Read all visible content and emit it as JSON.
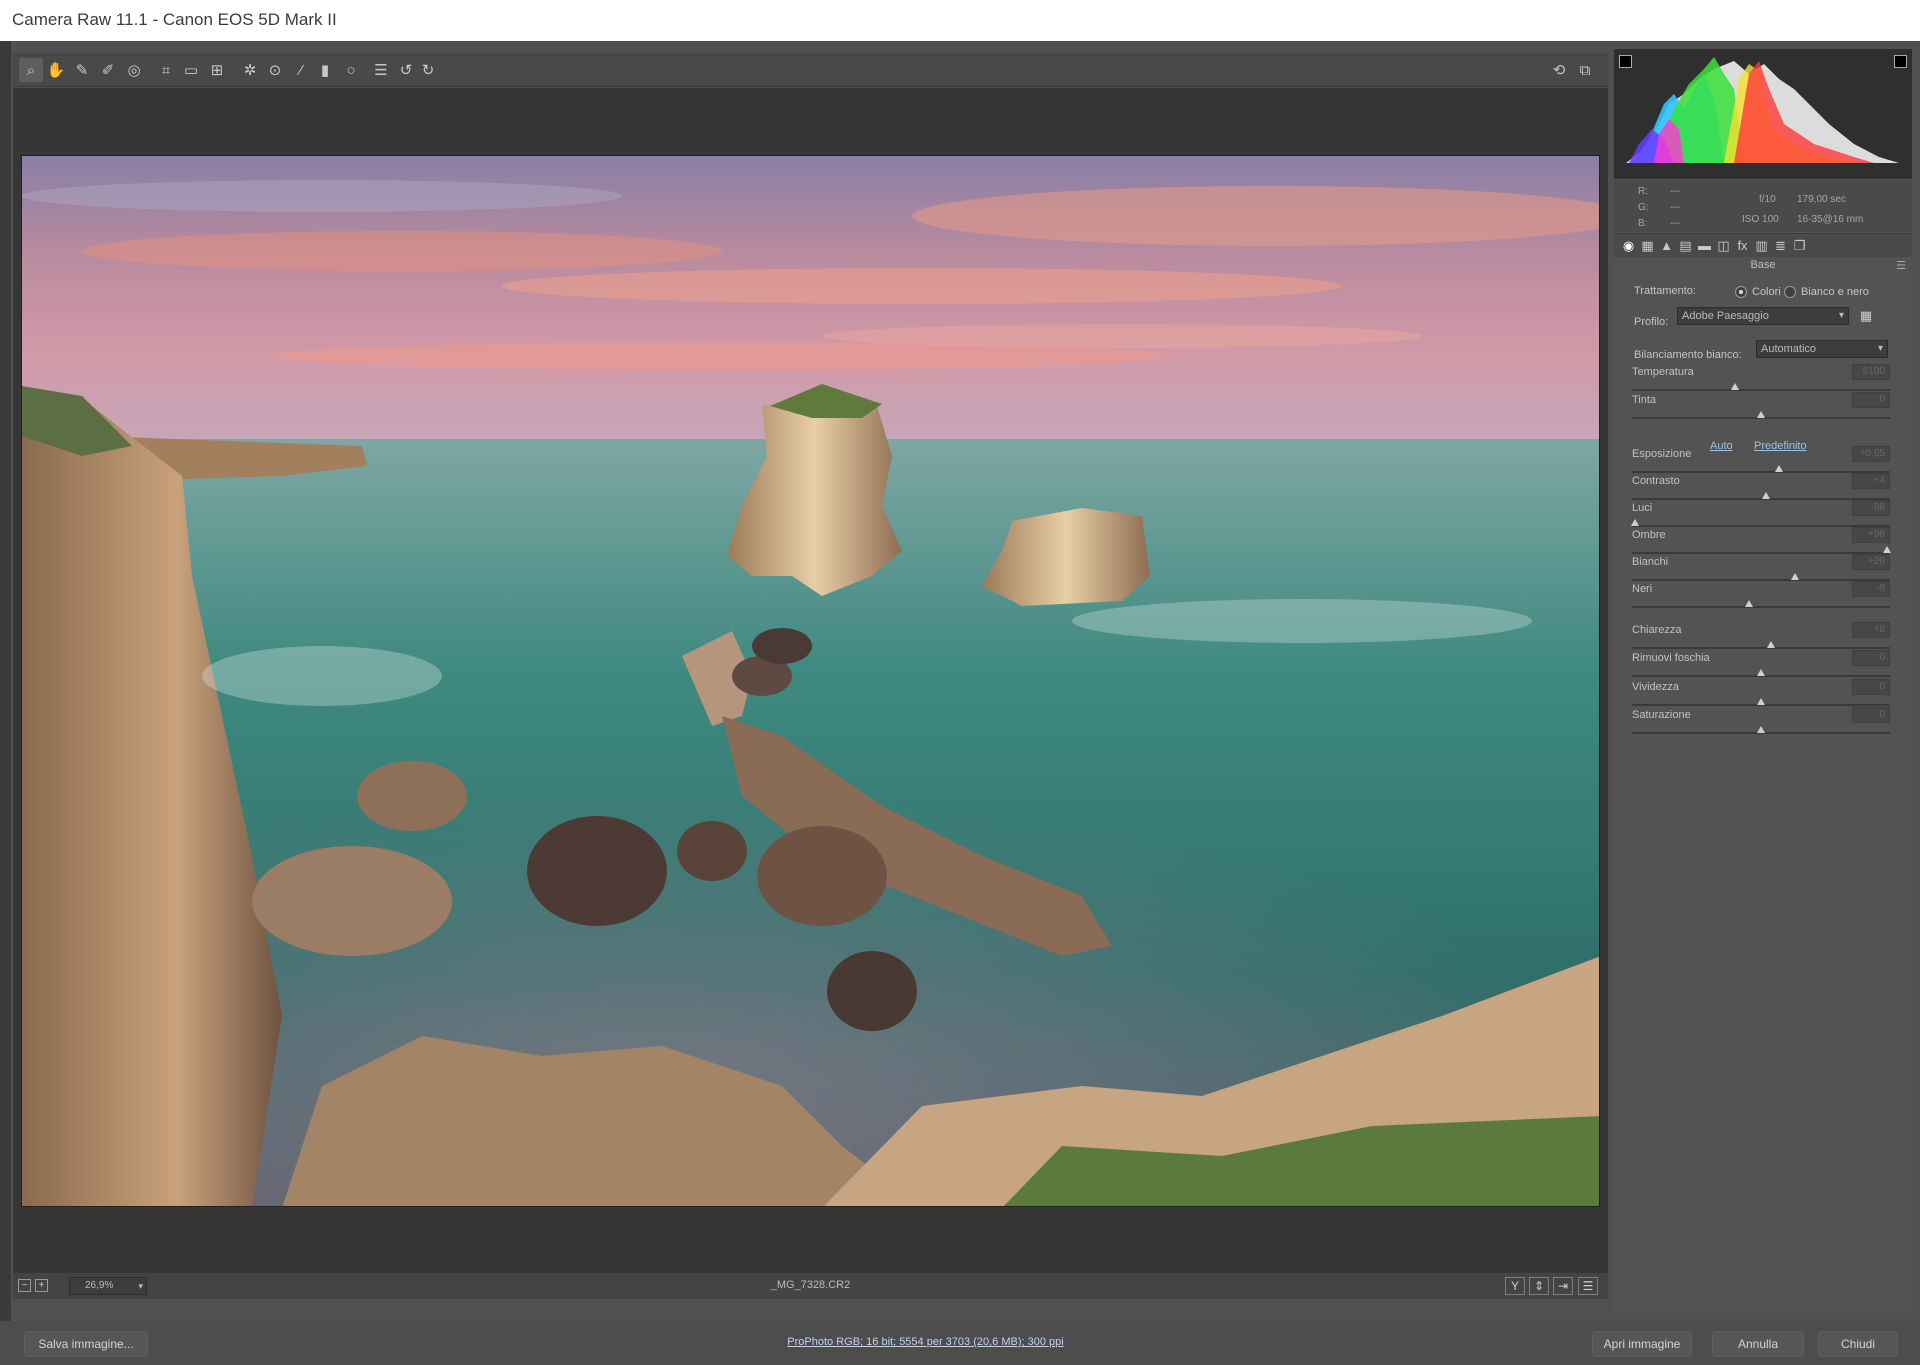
{
  "window": {
    "title": "Camera Raw 11.1  -  Canon EOS 5D Mark II"
  },
  "toolbar": {
    "tools": [
      {
        "name": "zoom-tool",
        "icon": "magnifier-icon",
        "glyph": "⌕"
      },
      {
        "name": "hand-tool",
        "icon": "hand-icon",
        "glyph": "✋"
      },
      {
        "name": "white-balance-tool",
        "icon": "eyedropper-icon",
        "glyph": "✎"
      },
      {
        "name": "color-sampler-tool",
        "icon": "color-sampler-icon",
        "glyph": "✐"
      },
      {
        "name": "targeted-adjustment-tool",
        "icon": "target-adjust-icon",
        "glyph": "◎"
      },
      {
        "name": "crop-tool",
        "icon": "crop-icon",
        "glyph": "⌗"
      },
      {
        "name": "straighten-tool",
        "icon": "straighten-icon",
        "glyph": "▭"
      },
      {
        "name": "transform-tool",
        "icon": "transform-icon",
        "glyph": "⊞"
      },
      {
        "name": "spot-removal-tool",
        "icon": "spot-removal-icon",
        "glyph": "✲"
      },
      {
        "name": "red-eye-tool",
        "icon": "red-eye-icon",
        "glyph": "⊙"
      },
      {
        "name": "adjustment-brush-tool",
        "icon": "brush-icon",
        "glyph": "⁄"
      },
      {
        "name": "graduated-filter-tool",
        "icon": "graduated-filter-icon",
        "glyph": "▮"
      },
      {
        "name": "radial-filter-tool",
        "icon": "radial-filter-icon",
        "glyph": "○"
      },
      {
        "name": "preferences-tool",
        "icon": "list-icon",
        "glyph": "☰"
      },
      {
        "name": "rotate-left-tool",
        "icon": "rotate-ccw-icon",
        "glyph": "↺"
      },
      {
        "name": "rotate-right-tool",
        "icon": "rotate-cw-icon",
        "glyph": "↻"
      }
    ],
    "right_tools": [
      {
        "name": "toggle-preview-tool",
        "icon": "sync-icon",
        "glyph": "⟲"
      },
      {
        "name": "fullscreen-tool",
        "icon": "fullscreen-icon",
        "glyph": "⧉"
      }
    ]
  },
  "viewer": {
    "zoom_out": "−",
    "zoom_in": "+",
    "zoom_level": "26,9%",
    "filename": "_MG_7328.CR2",
    "view_buttons": [
      {
        "name": "before-after-button",
        "icon": "before-after-icon",
        "glyph": "Y"
      },
      {
        "name": "swap-settings-button",
        "icon": "swap-icon",
        "glyph": "⇕"
      },
      {
        "name": "copy-settings-button",
        "icon": "copy-settings-icon",
        "glyph": "⇥"
      },
      {
        "name": "preview-prefs-button",
        "icon": "sliders-icon",
        "glyph": "☰"
      }
    ]
  },
  "info": {
    "r_label": "R:",
    "g_label": "G:",
    "b_label": "B:",
    "r_value": "---",
    "g_value": "---",
    "b_value": "---",
    "aperture": "f/10",
    "shutter": "179,00 sec",
    "iso": "ISO 100",
    "lens": "16-35@16 mm"
  },
  "panel_tabs": [
    {
      "name": "tab-base",
      "icon": "aperture-icon",
      "glyph": "◉"
    },
    {
      "name": "tab-tone-curve",
      "icon": "grid-icon",
      "glyph": "▦"
    },
    {
      "name": "tab-detail",
      "icon": "mountain-icon",
      "glyph": "▲"
    },
    {
      "name": "tab-hsl",
      "icon": "hsl-icon",
      "glyph": "▤"
    },
    {
      "name": "tab-split-toning",
      "icon": "split-toning-icon",
      "glyph": "▬"
    },
    {
      "name": "tab-lens",
      "icon": "lens-icon",
      "glyph": "◫"
    },
    {
      "name": "tab-effects",
      "icon": "fx-icon",
      "glyph": "fx"
    },
    {
      "name": "tab-calibration",
      "icon": "calibration-icon",
      "glyph": "▥"
    },
    {
      "name": "tab-presets",
      "icon": "presets-icon",
      "glyph": "≣"
    },
    {
      "name": "tab-snapshots",
      "icon": "snapshots-icon",
      "glyph": "❐"
    }
  ],
  "base": {
    "section_title": "Base",
    "treatment_label": "Trattamento:",
    "treatment_color": "Colori",
    "treatment_bw": "Bianco e nero",
    "profile_label": "Profilo:",
    "profile_value": "Adobe Paesaggio",
    "wb_label": "Bilanciamento bianco:",
    "wb_value": "Automatico",
    "auto_link": "Auto",
    "default_link": "Predefinito",
    "sliders": [
      {
        "name": "temperature",
        "label": "Temperatura",
        "value": "6100",
        "pos": 0.4
      },
      {
        "name": "tint",
        "label": "Tinta",
        "value": "0",
        "pos": 0.5
      },
      {
        "name": "exposure",
        "label": "Esposizione",
        "value": "+0,65",
        "pos": 0.57
      },
      {
        "name": "contrast",
        "label": "Contrasto",
        "value": "+4",
        "pos": 0.52
      },
      {
        "name": "highlights",
        "label": "Luci",
        "value": "-98",
        "pos": 0.01
      },
      {
        "name": "shadows",
        "label": "Ombre",
        "value": "+98",
        "pos": 0.99
      },
      {
        "name": "whites",
        "label": "Bianchi",
        "value": "+26",
        "pos": 0.63
      },
      {
        "name": "blacks",
        "label": "Neri",
        "value": "-9",
        "pos": 0.455
      },
      {
        "name": "clarity",
        "label": "Chiarezza",
        "value": "+8",
        "pos": 0.54
      },
      {
        "name": "dehaze",
        "label": "Rimuovi foschia",
        "value": "0",
        "pos": 0.5
      },
      {
        "name": "vibrance",
        "label": "Vividezza",
        "value": "0",
        "pos": 0.5
      },
      {
        "name": "saturation",
        "label": "Saturazione",
        "value": "0",
        "pos": 0.5
      }
    ]
  },
  "footer": {
    "save_label": "Salva immagine...",
    "workflow_label": "ProPhoto RGB; 16 bit; 5554 per 3703 (20,6 MB); 300 ppi",
    "open_label": "Apri immagine",
    "cancel_label": "Annulla",
    "close_label": "Chiudi"
  }
}
